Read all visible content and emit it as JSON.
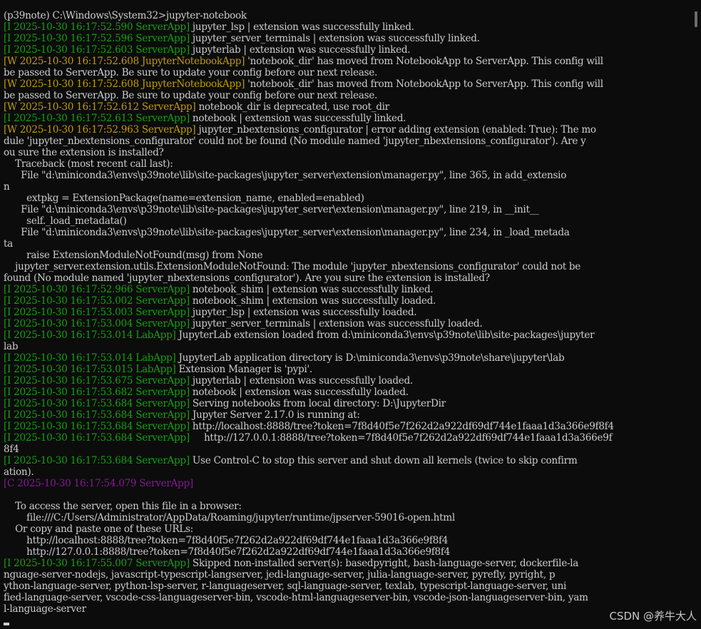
{
  "terminal": {
    "lines": [
      {
        "text": "(p39note) C:\\Windows\\System32>jupyter-notebook"
      },
      {
        "tag": "[I 2025-10-30 16:17:52.590 ServerApp]",
        "level": "I",
        "text": " jupyter_lsp | extension was successfully linked."
      },
      {
        "tag": "[I 2025-10-30 16:17:52.596 ServerApp]",
        "level": "I",
        "text": " jupyter_server_terminals | extension was successfully linked."
      },
      {
        "tag": "[I 2025-10-30 16:17:52.603 ServerApp]",
        "level": "I",
        "text": " jupyterlab | extension was successfully linked."
      },
      {
        "tag": "[W 2025-10-30 16:17:52.608 JupyterNotebookApp]",
        "level": "W",
        "text": " 'notebook_dir' has moved from NotebookApp to ServerApp. This config will"
      },
      {
        "text": "be passed to ServerApp. Be sure to update your config before our next release."
      },
      {
        "tag": "[W 2025-10-30 16:17:52.608 JupyterNotebookApp]",
        "level": "W",
        "text": " 'notebook_dir' has moved from NotebookApp to ServerApp. This config will"
      },
      {
        "text": "be passed to ServerApp. Be sure to update your config before our next release."
      },
      {
        "tag": "[W 2025-10-30 16:17:52.612 ServerApp]",
        "level": "W",
        "text": " notebook_dir is deprecated, use root_dir"
      },
      {
        "tag": "[I 2025-10-30 16:17:52.613 ServerApp]",
        "level": "I",
        "text": " notebook | extension was successfully linked."
      },
      {
        "tag": "[W 2025-10-30 16:17:52.963 ServerApp]",
        "level": "W",
        "text": " jupyter_nbextensions_configurator | error adding extension (enabled: True): The mo"
      },
      {
        "text": "dule 'jupyter_nbextensions_configurator' could not be found (No module named 'jupyter_nbextensions_configurator'). Are y"
      },
      {
        "text": "ou sure the extension is installed?"
      },
      {
        "text": "    Traceback (most recent call last):"
      },
      {
        "text": "      File \"d:\\miniconda3\\envs\\p39note\\lib\\site-packages\\jupyter_server\\extension\\manager.py\", line 365, in add_extensio"
      },
      {
        "text": "n"
      },
      {
        "text": "        extpkg = ExtensionPackage(name=extension_name, enabled=enabled)"
      },
      {
        "text": "      File \"d:\\miniconda3\\envs\\p39note\\lib\\site-packages\\jupyter_server\\extension\\manager.py\", line 219, in __init__"
      },
      {
        "text": "        self._load_metadata()"
      },
      {
        "text": "      File \"d:\\miniconda3\\envs\\p39note\\lib\\site-packages\\jupyter_server\\extension\\manager.py\", line 234, in _load_metada"
      },
      {
        "text": "ta"
      },
      {
        "text": "        raise ExtensionModuleNotFound(msg) from None"
      },
      {
        "text": "    jupyter_server.extension.utils.ExtensionModuleNotFound: The module 'jupyter_nbextensions_configurator' could not be"
      },
      {
        "text": "found (No module named 'jupyter_nbextensions_configurator'). Are you sure the extension is installed?"
      },
      {
        "tag": "[I 2025-10-30 16:17:52.966 ServerApp]",
        "level": "I",
        "text": " notebook_shim | extension was successfully linked."
      },
      {
        "tag": "[I 2025-10-30 16:17:53.002 ServerApp]",
        "level": "I",
        "text": " notebook_shim | extension was successfully loaded."
      },
      {
        "tag": "[I 2025-10-30 16:17:53.003 ServerApp]",
        "level": "I",
        "text": " jupyter_lsp | extension was successfully loaded."
      },
      {
        "tag": "[I 2025-10-30 16:17:53.004 ServerApp]",
        "level": "I",
        "text": " jupyter_server_terminals | extension was successfully loaded."
      },
      {
        "tag": "[I 2025-10-30 16:17:53.014 LabApp]",
        "level": "I",
        "text": " JupyterLab extension loaded from d:\\miniconda3\\envs\\p39note\\lib\\site-packages\\jupyter"
      },
      {
        "text": "lab"
      },
      {
        "tag": "[I 2025-10-30 16:17:53.014 LabApp]",
        "level": "I",
        "text": " JupyterLab application directory is D:\\miniconda3\\envs\\p39note\\share\\jupyter\\lab"
      },
      {
        "tag": "[I 2025-10-30 16:17:53.015 LabApp]",
        "level": "I",
        "text": " Extension Manager is 'pypi'."
      },
      {
        "tag": "[I 2025-10-30 16:17:53.675 ServerApp]",
        "level": "I",
        "text": " jupyterlab | extension was successfully loaded."
      },
      {
        "tag": "[I 2025-10-30 16:17:53.682 ServerApp]",
        "level": "I",
        "text": " notebook | extension was successfully loaded."
      },
      {
        "tag": "[I 2025-10-30 16:17:53.684 ServerApp]",
        "level": "I",
        "text": " Serving notebooks from local directory: D:\\JupyterDir"
      },
      {
        "tag": "[I 2025-10-30 16:17:53.684 ServerApp]",
        "level": "I",
        "text": " Jupyter Server 2.17.0 is running at:"
      },
      {
        "tag": "[I 2025-10-30 16:17:53.684 ServerApp]",
        "level": "I",
        "text": " http://localhost:8888/tree?token=7f8d40f5e7f262d2a922df69df744e1faaa1d3a366e9f8f4"
      },
      {
        "tag": "[I 2025-10-30 16:17:53.684 ServerApp]",
        "level": "I",
        "text": "     http://127.0.0.1:8888/tree?token=7f8d40f5e7f262d2a922df69df744e1faaa1d3a366e9f"
      },
      {
        "text": "8f4"
      },
      {
        "tag": "[I 2025-10-30 16:17:53.684 ServerApp]",
        "level": "I",
        "text": " Use Control-C to stop this server and shut down all kernels (twice to skip confirm"
      },
      {
        "text": "ation)."
      },
      {
        "tag": "[C 2025-10-30 16:17:54.079 ServerApp]",
        "level": "C",
        "text": ""
      },
      {
        "text": ""
      },
      {
        "text": "    To access the server, open this file in a browser:"
      },
      {
        "text": "        file:///C:/Users/Administrator/AppData/Roaming/jupyter/runtime/jpserver-59016-open.html"
      },
      {
        "text": "    Or copy and paste one of these URLs:"
      },
      {
        "text": "        http://localhost:8888/tree?token=7f8d40f5e7f262d2a922df69df744e1faaa1d3a366e9f8f4"
      },
      {
        "text": "        http://127.0.0.1:8888/tree?token=7f8d40f5e7f262d2a922df69df744e1faaa1d3a366e9f8f4"
      },
      {
        "tag": "[I 2025-10-30 16:17:55.007 ServerApp]",
        "level": "I",
        "text": " Skipped non-installed server(s): basedpyright, bash-language-server, dockerfile-la"
      },
      {
        "text": "nguage-server-nodejs, javascript-typescript-langserver, jedi-language-server, julia-language-server, pyrefly, pyright, p"
      },
      {
        "text": "ython-language-server, python-lsp-server, r-languageserver, sql-language-server, texlab, typescript-language-server, uni"
      },
      {
        "text": "fied-language-server, vscode-css-languageserver-bin, vscode-html-languageserver-bin, vscode-json-languageserver-bin, yam"
      },
      {
        "text": "l-language-server"
      }
    ]
  },
  "watermark": "CSDN @养牛大人",
  "colors": {
    "background": "#0c0c0c",
    "text": "#cccccc",
    "info_tag": "#13a10e",
    "warn_tag": "#c19c00",
    "critical_tag": "#881798"
  }
}
